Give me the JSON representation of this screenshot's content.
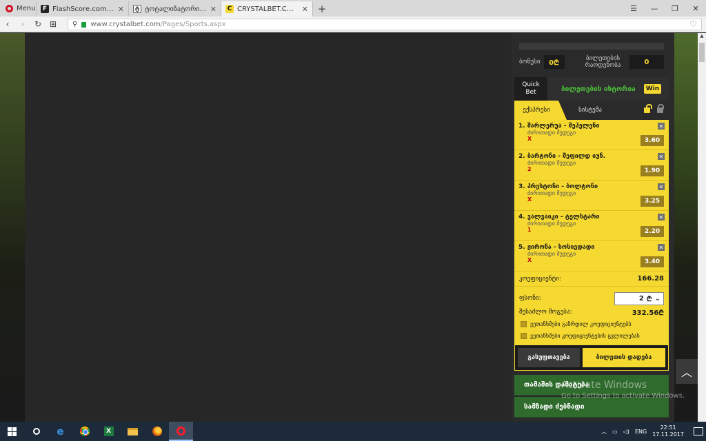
{
  "browser": {
    "menu_label": "Menu",
    "tabs": [
      {
        "label": "FlashScore.com: Live Socc",
        "favicon": "flashscore-icon"
      },
      {
        "label": "ტოტალიზატორი -> თი",
        "favicon": "totalizator-icon"
      },
      {
        "label": "CRYSTALBET.COM - ონლა",
        "favicon": "crystalbet-icon",
        "active": true
      }
    ],
    "url_domain": "www.crystalbet.com",
    "url_path": "/Pages/Sports.aspx"
  },
  "panel": {
    "bonus_label": "ბონუსი",
    "bonus_value": "0₾",
    "tickets_label_line1": "ბილეთების",
    "tickets_label_line2": "რაოდენობა",
    "tickets_value": "0",
    "quick_bet_line1": "Quick",
    "quick_bet_line2": "Bet",
    "history_label": "ბილეთების ისტორია",
    "win_badge": "Win",
    "tab_express": "ექსპრესი",
    "tab_system": "სისტემა",
    "bets": [
      {
        "title": "1. შარლერუა - მეჰელენი",
        "market": "ძირითადი შედეგი",
        "pick": "X",
        "odds": "3.60"
      },
      {
        "title": "2. ბარტონი - შეფილდ იუნ.",
        "market": "ძირითადი შედეგი",
        "pick": "2",
        "odds": "1.90"
      },
      {
        "title": "3. პრესტონი - ბოლტონი",
        "market": "ძირითადი შედეგი",
        "pick": "X",
        "odds": "3.25"
      },
      {
        "title": "4. ვალვაიკი - ტელსტარი",
        "market": "ძირითადი შედეგი",
        "pick": "1",
        "odds": "2.20"
      },
      {
        "title": "5. ჟირონა - სოსიედადი",
        "market": "ძირითადი შედეგი",
        "pick": "X",
        "odds": "3.40"
      }
    ],
    "coef_label": "კოეფიციენტი:",
    "coef_value": "166.28",
    "stake_label": "ფსონი:",
    "stake_value": "2",
    "stake_currency": "₾",
    "payout_label": "შესაძლო მოგება:",
    "payout_value": "332.56₾",
    "option1": "ვეთანხმები გაზრდილ კოეფიციენტებს",
    "option2": "ვეთანხმები კოეფიციენტების ცვლილებას",
    "btn_clear": "გასუფთავება",
    "btn_place": "ბილეთის დადება",
    "btn_game_rules": "თამაშის დამატება",
    "btn_search": "სამზადი ძებნადი"
  },
  "watermark": {
    "line1": "Activate Windows",
    "line2": "Go to Settings to activate Windows."
  },
  "taskbar": {
    "lang": "ENG",
    "time": "22:51",
    "date": "17.11.2017"
  },
  "colors": {
    "accent_yellow": "#f6d930",
    "history_green": "#4ec13c",
    "cta_green": "#2e6b2c"
  }
}
